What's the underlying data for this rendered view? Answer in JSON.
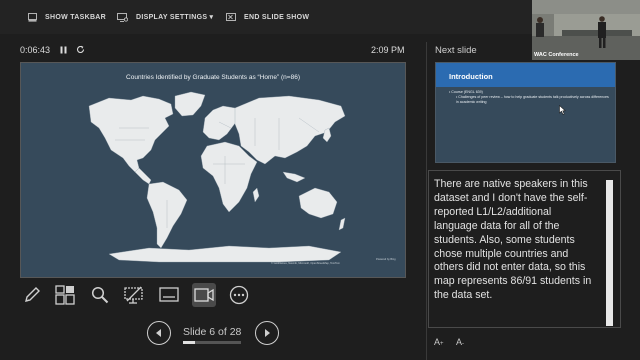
{
  "toolbar": {
    "show_taskbar": "SHOW TASKBAR",
    "display_settings": "DISPLAY SETTINGS ▾",
    "end_slide_show": "END SLIDE SHOW"
  },
  "presenter": {
    "elapsed_time": "0:06:43",
    "clock": "2:09 PM"
  },
  "current_slide": {
    "title": "Countries Identified by Graduate Students as “Home” (n=86)",
    "map_credit": "© GeoNames, Navinfo, Microsoft, OpenStreetMap, TomTom",
    "map_credit_2": "Powered by Bing"
  },
  "tools": [
    "pen-icon",
    "slide-grid-icon",
    "zoom-icon",
    "pointer-screen-icon",
    "subtitles-icon",
    "camera-icon",
    "more-options-icon"
  ],
  "navigation": {
    "slide_counter": "Slide 6 of 28",
    "progress_fraction": 0.214
  },
  "next_slide": {
    "label": "Next slide",
    "title": "Introduction",
    "bullet_1": "• Course (ENGL 639)",
    "bullet_2": "• Challenges of peer review – how to help graduate students talk productively across differences in academic writing"
  },
  "notes": {
    "text": "There are native speakers in this dataset and I don't have the self-reported L1/L2/additional language data for all of the students. Also, some students chose multiple countries and others did not enter data, so this map represents 86/91 students in the data set."
  },
  "font_controls": {
    "increase": "A",
    "decrease": "A"
  },
  "video_overlay": {
    "label": "WAC Conference"
  },
  "colors": {
    "slide_background": "#364a5b",
    "land": "#e9ebec",
    "next_title_band": "#2b6bb1"
  }
}
